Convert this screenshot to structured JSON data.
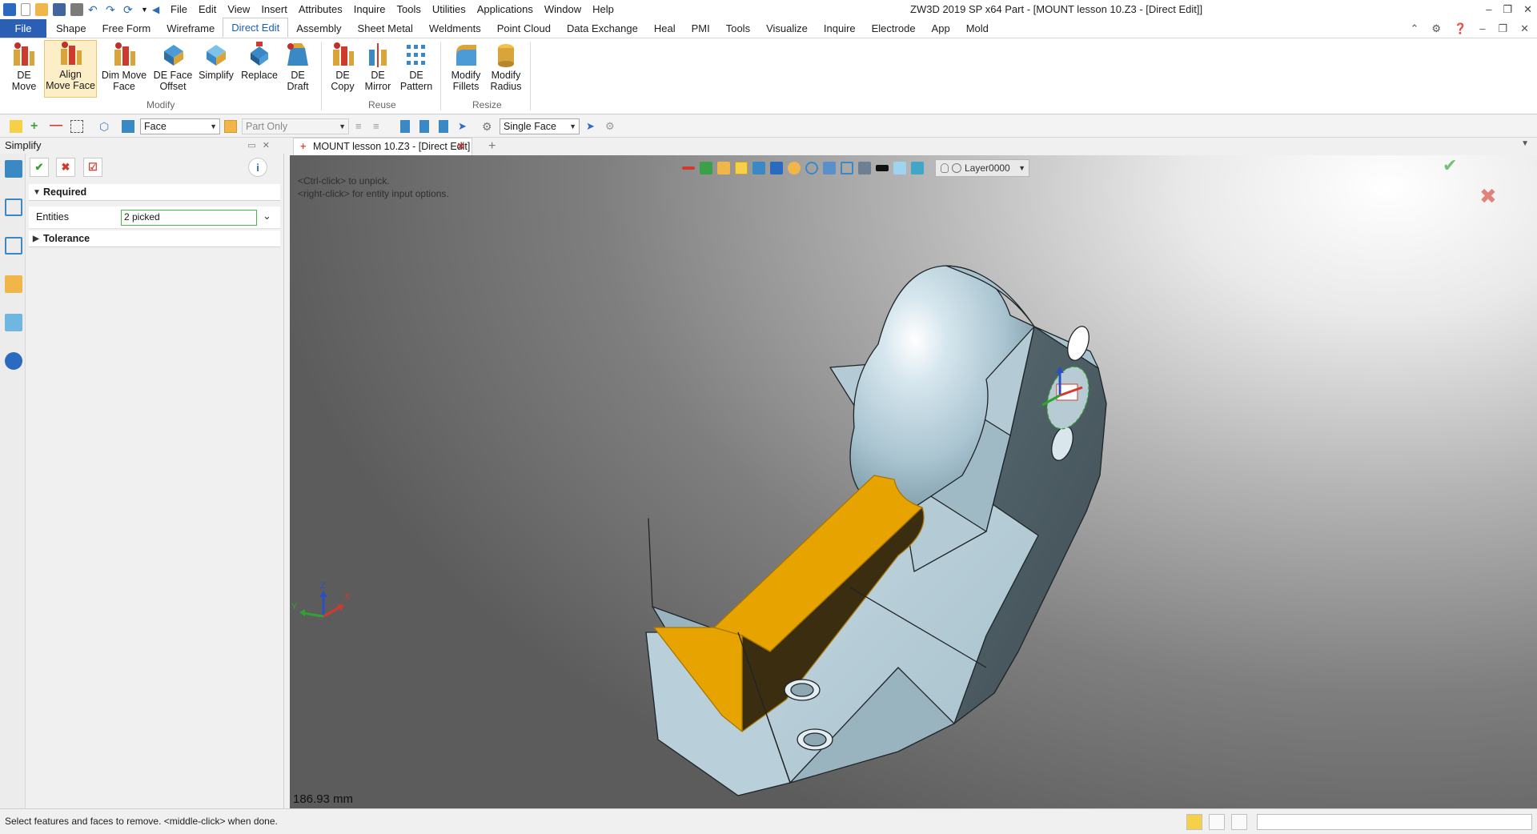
{
  "app": {
    "window_title": "ZW3D 2019 SP x64       Part - [MOUNT lesson 10.Z3 - [Direct Edit]]"
  },
  "menubar": [
    "File",
    "Edit",
    "View",
    "Insert",
    "Attributes",
    "Inquire",
    "Tools",
    "Utilities",
    "Applications",
    "Window",
    "Help"
  ],
  "ribbon_tabs": [
    "File",
    "Shape",
    "Free Form",
    "Wireframe",
    "Direct Edit",
    "Assembly",
    "Sheet Metal",
    "Weldments",
    "Point Cloud",
    "Data Exchange",
    "Heal",
    "PMI",
    "Tools",
    "Visualize",
    "Inquire",
    "Electrode",
    "App",
    "Mold"
  ],
  "active_tab": "Direct Edit",
  "ribbon": {
    "modify": {
      "label": "Modify",
      "buttons": [
        {
          "line1": "DE",
          "line2": "Move"
        },
        {
          "line1": "Align",
          "line2": "Move Face"
        },
        {
          "line1": "Dim Move",
          "line2": "Face"
        },
        {
          "line1": "DE Face",
          "line2": "Offset"
        },
        {
          "line1": "Simplify",
          "line2": ""
        },
        {
          "line1": "Replace",
          "line2": ""
        },
        {
          "line1": "DE",
          "line2": "Draft"
        }
      ]
    },
    "reuse": {
      "label": "Reuse",
      "buttons": [
        {
          "line1": "DE",
          "line2": "Copy"
        },
        {
          "line1": "DE",
          "line2": "Mirror"
        },
        {
          "line1": "DE",
          "line2": "Pattern"
        }
      ]
    },
    "resize": {
      "label": "Resize",
      "buttons": [
        {
          "line1": "Modify",
          "line2": "Fillets"
        },
        {
          "line1": "Modify",
          "line2": "Radius"
        }
      ]
    }
  },
  "toolbar": {
    "filter_value": "Face",
    "scope_value": "Part Only",
    "pick_mode_value": "Single Face"
  },
  "panel": {
    "title": "Simplify",
    "required_label": "Required",
    "entities_label": "Entities",
    "entities_value": "2 picked",
    "tolerance_label": "Tolerance"
  },
  "document": {
    "tab_label": "MOUNT lesson 10.Z3 - [Direct Edit]"
  },
  "viewport": {
    "prompt_line1": "<Ctrl-click> to unpick.",
    "prompt_line2": "<right-click> for entity input options.",
    "layer": "Layer0000",
    "scale": "186.93 mm",
    "axis_labels": {
      "x": "X",
      "y": "Y",
      "z": "Z"
    }
  },
  "statusbar": {
    "message": "Select features and faces to remove.  <middle-click> when done."
  },
  "colors": {
    "file_tab": "#2b5fb3",
    "selected_face": "#e7a400",
    "part_face": "#b5ccd6",
    "accept": "#2fa32f",
    "cancel": "#d33a2c"
  }
}
